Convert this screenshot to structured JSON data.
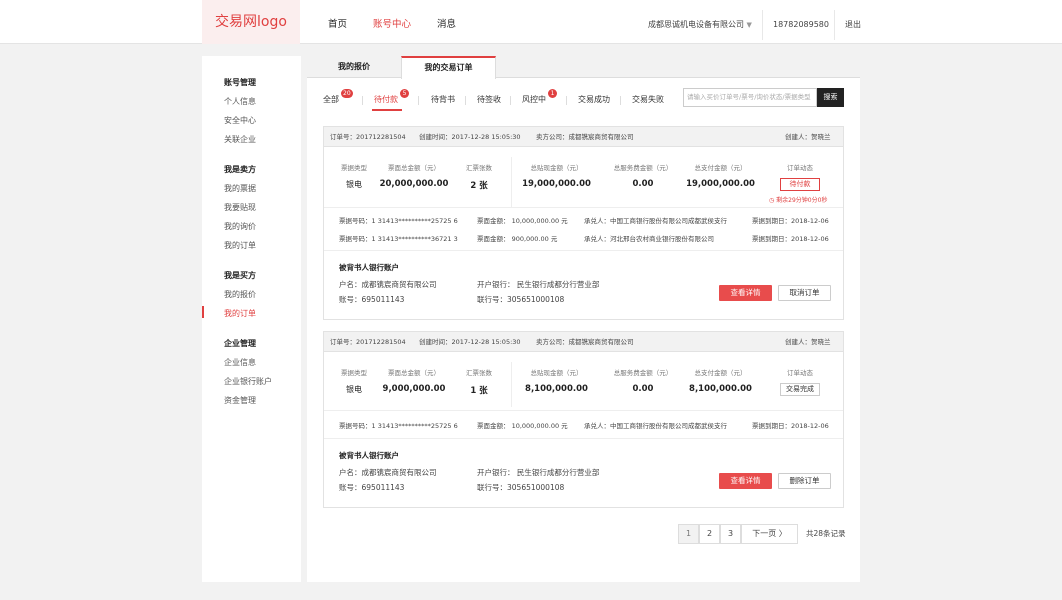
{
  "header": {
    "logo": "交易网logo",
    "nav": [
      "首页",
      "账号中心",
      "消息"
    ],
    "company": "成都思诚机电设备有限公司",
    "phone": "18782089580",
    "logout": "退出"
  },
  "sidebar": {
    "groups": [
      {
        "title": "账号管理",
        "items": [
          "个人信息",
          "安全中心",
          "关联企业"
        ]
      },
      {
        "title": "我是卖方",
        "items": [
          "我的票据",
          "我要贴现",
          "我的询价",
          "我的订单"
        ]
      },
      {
        "title": "我是买方",
        "items": [
          "我的报价",
          "我的订单"
        ]
      },
      {
        "title": "企业管理",
        "items": [
          "企业信息",
          "企业银行账户",
          "资金管理"
        ]
      }
    ],
    "active": "我的订单"
  },
  "tabs": [
    "我的报价",
    "我的交易订单"
  ],
  "filters": [
    {
      "label": "全部",
      "badge": "20"
    },
    {
      "label": "待付款",
      "badge": "5"
    },
    {
      "label": "待背书",
      "badge": ""
    },
    {
      "label": "待签收",
      "badge": ""
    },
    {
      "label": "风控中",
      "badge": "1"
    },
    {
      "label": "交易成功",
      "badge": ""
    },
    {
      "label": "交易失败",
      "badge": ""
    }
  ],
  "search": {
    "placeholder": "请输入买价订单号/票号/询价状态/票据类型",
    "button": "搜索"
  },
  "col_labels": [
    "票据类型",
    "票面总金额（元）",
    "汇票张数",
    "总贴现金额（元）",
    "总服务费金额（元）",
    "总支付金额（元）",
    "订单动态"
  ],
  "orders": [
    {
      "order_no": "订单号：201712281504",
      "created": "创建时间：2017-12-28  15:05:30",
      "seller": "卖方公司：成都镌宸商贸有限公司",
      "creator": "创建人：贺晓兰",
      "type": "银电",
      "face": "20,000,000.00",
      "count": "2 张",
      "discount": "19,000,000.00",
      "fee": "0.00",
      "pay": "19,000,000.00",
      "status": "待付款",
      "countdown": "剩余29分钟0分0秒",
      "bills": [
        {
          "no": "票据号码：1 31413**********25725 6",
          "amount": "票面金额：  10,000,000.00  元",
          "acceptor": "承兑人：中国工商银行股份有限公司成都武侯支行",
          "due": "票据到期日：2018-12-06"
        },
        {
          "no": "票据号码：1 31413**********36721 3",
          "amount": "票面金额：  900,000.00  元",
          "acceptor": "承兑人：河北邢台农村商业银行股份有限公司",
          "due": "票据到期日：2018-12-06"
        }
      ],
      "account_title": "被背书人银行账户",
      "account_name": "户名：成都镌宸商贸有限公司",
      "account_no": "账号：695011143",
      "bank": "开户银行：  民生银行成都分行营业部",
      "bank_no": "联行号：305651000108",
      "btn1": "查看详情",
      "btn2": "取消订单"
    },
    {
      "order_no": "订单号：201712281504",
      "created": "创建时间：2017-12-28  15:05:30",
      "seller": "卖方公司：成都镌宸商贸有限公司",
      "creator": "创建人：贺晓兰",
      "type": "银电",
      "face": "9,000,000.00",
      "count": "1 张",
      "discount": "8,100,000.00",
      "fee": "0.00",
      "pay": "8,100,000.00",
      "status": "交易完成",
      "countdown": "",
      "bills": [
        {
          "no": "票据号码：1 31413**********25725 6",
          "amount": "票面金额：  10,000,000.00  元",
          "acceptor": "承兑人：中国工商银行股份有限公司成都武侯支行",
          "due": "票据到期日：2018-12-06"
        }
      ],
      "account_title": "被背书人银行账户",
      "account_name": "户名：成都镌宸商贸有限公司",
      "account_no": "账号：695011143",
      "bank": "开户银行：  民生银行成都分行营业部",
      "bank_no": "联行号：305651000108",
      "btn1": "查看详情",
      "btn2": "删除订单"
    }
  ],
  "pagination": {
    "pages": [
      "1",
      "2",
      "3"
    ],
    "next": "下一页 〉",
    "total": "共28条记录"
  },
  "colors": {
    "accent": "#e04040",
    "button_red": "#e84c4c"
  }
}
